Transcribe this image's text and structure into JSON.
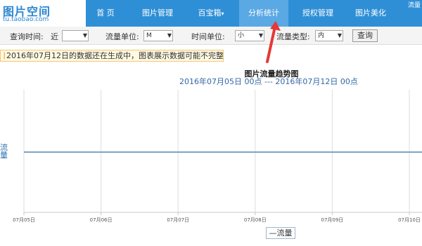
{
  "logo": {
    "title": "图片空间",
    "domain": "tu.taobao.com"
  },
  "nav": {
    "items": [
      {
        "label": "首 页"
      },
      {
        "label": "图片管理"
      },
      {
        "label": "百宝箱"
      },
      {
        "label": "分析统计"
      },
      {
        "label": "授权管理"
      },
      {
        "label": "图片美化"
      }
    ],
    "corner_text": "流量"
  },
  "filters": {
    "query_time_label": "查询时间:",
    "query_time_prefix": "近",
    "query_time_value": "",
    "traffic_unit_label": "流量单位:",
    "traffic_unit_value": "M",
    "time_unit_label": "时间单位:",
    "time_unit_value": "小",
    "traffic_type_label": "流量类型:",
    "traffic_type_value": "内",
    "query_button": "查询"
  },
  "notice": {
    "text": "2016年07月12日的数据还在生成中，图表展示数据可能不完整..."
  },
  "chart_data": {
    "type": "line",
    "title": "图片流量趋势图",
    "subtitle": "2016年07月05日 00点 --- 2016年07月12日 00点",
    "ylabel": "流量",
    "xlabel": "",
    "x_ticks": [
      "07月05日",
      "07月06日",
      "07月07日",
      "07月08日",
      "07月09日",
      "07月10日"
    ],
    "grid": true,
    "legend_position": "bottom-center",
    "series": [
      {
        "name": "流量",
        "values": [
          0,
          0,
          0,
          0,
          0,
          0
        ],
        "color": "#4f86b8"
      }
    ]
  }
}
